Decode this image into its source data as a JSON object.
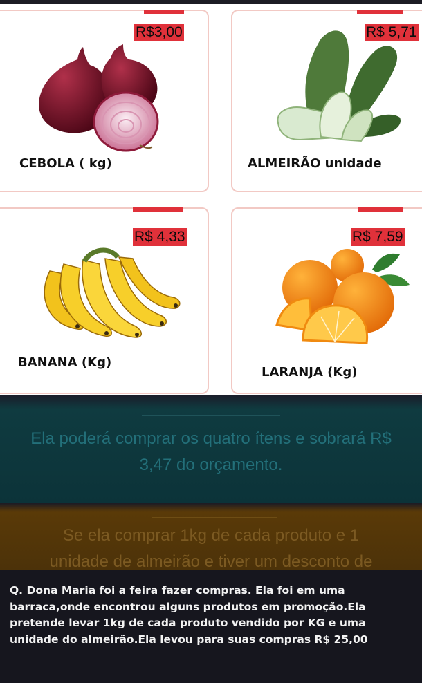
{
  "products": [
    {
      "name": "CEBOLA ( kg)",
      "price": "R$3,00",
      "image": "onion"
    },
    {
      "name": "ALMEIRÃO unidade",
      "price": "R$ 5,71",
      "image": "bok-choy"
    },
    {
      "name": "BANANA (Kg)",
      "price": "R$ 4,33",
      "image": "bananas"
    },
    {
      "name": "LARANJA (Kg)",
      "price": "R$ 7,59",
      "image": "oranges"
    }
  ],
  "answers": [
    {
      "text": "Ela poderá comprar os quatro ítens e sobrará R$ 3,47 do orçamento.",
      "color": "#23707a"
    },
    {
      "text": "Se ela comprar 1kg de cada produto e 1 unidade de almeirão e tiver um desconto de",
      "color": "#7c5a22"
    }
  ],
  "question": {
    "text": "Q. Dona Maria foi a feira fazer compras. Ela foi em uma barraca,onde encontrou alguns produtos em promoção.Ela pretende levar 1kg de cada produto vendido por KG e uma unidade do almeirão.Ela levou para suas compras R$ 25,00"
  },
  "colors": {
    "price_tag": "#e0313a",
    "card_border": "#f2c9c4",
    "background": "#16161e"
  }
}
